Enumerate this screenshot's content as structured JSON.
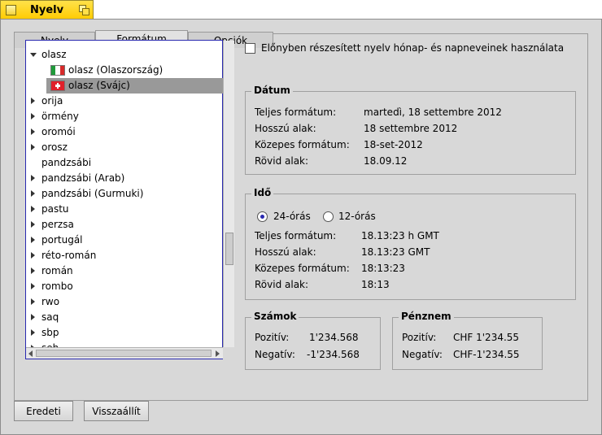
{
  "window": {
    "title": "Nyelv"
  },
  "tabs": [
    {
      "label": "Nyelv",
      "active": false
    },
    {
      "label": "Formátum",
      "active": true
    },
    {
      "label": "Opciók",
      "active": false
    }
  ],
  "list": {
    "items": [
      {
        "label": "olasz",
        "expanded": true,
        "indent": 0
      },
      {
        "label": "olasz (Olaszország)",
        "flag": "it",
        "indent": 1
      },
      {
        "label": "olasz (Svájc)",
        "flag": "ch",
        "indent": 1,
        "selected": true
      },
      {
        "label": "orija",
        "expandable": true,
        "indent": 0
      },
      {
        "label": "örmény",
        "expandable": true,
        "indent": 0
      },
      {
        "label": "oromói",
        "expandable": true,
        "indent": 0
      },
      {
        "label": "orosz",
        "expandable": true,
        "indent": 0
      },
      {
        "label": "pandzsábi",
        "expandable": false,
        "indent": 0
      },
      {
        "label": "pandzsábi (Arab)",
        "expandable": true,
        "indent": 0
      },
      {
        "label": "pandzsábi (Gurmuki)",
        "expandable": true,
        "indent": 0
      },
      {
        "label": "pastu",
        "expandable": true,
        "indent": 0
      },
      {
        "label": "perzsa",
        "expandable": true,
        "indent": 0
      },
      {
        "label": "portugál",
        "expandable": true,
        "indent": 0
      },
      {
        "label": "réto-román",
        "expandable": true,
        "indent": 0
      },
      {
        "label": "román",
        "expandable": true,
        "indent": 0
      },
      {
        "label": "rombo",
        "expandable": true,
        "indent": 0
      },
      {
        "label": "rwo",
        "expandable": true,
        "indent": 0
      },
      {
        "label": "saq",
        "expandable": true,
        "indent": 0
      },
      {
        "label": "sbp",
        "expandable": true,
        "indent": 0
      },
      {
        "label": "seh",
        "expandable": true,
        "indent": 0
      }
    ]
  },
  "preferred_checkbox": {
    "label": "Előnyben részesített nyelv hónap- és napneveinek használata",
    "checked": false
  },
  "date": {
    "title": "Dátum",
    "rows": [
      {
        "label": "Teljes formátum:",
        "value": "martedì, 18 settembre 2012"
      },
      {
        "label": "Hosszú alak:",
        "value": "18 settembre 2012"
      },
      {
        "label": "Közepes formátum:",
        "value": "18-set-2012"
      },
      {
        "label": "Rövid alak:",
        "value": "18.09.12"
      }
    ]
  },
  "time": {
    "title": "Idő",
    "radio_24": "24-órás",
    "radio_12": "12-órás",
    "selected": "24",
    "rows": [
      {
        "label": "Teljes formátum:",
        "value": "18.13:23 h GMT"
      },
      {
        "label": "Hosszú alak:",
        "value": "18.13:23 GMT"
      },
      {
        "label": "Közepes formátum:",
        "value": "18:13:23"
      },
      {
        "label": "Rövid alak:",
        "value": "18:13"
      }
    ]
  },
  "numbers": {
    "title": "Számok",
    "positive_label": "Pozitív:",
    "positive_value": "1'234.568",
    "negative_label": "Negatív:",
    "negative_value": "-1'234.568"
  },
  "currency": {
    "title": "Pénznem",
    "positive_label": "Pozitív:",
    "positive_value": "CHF 1'234.55",
    "negative_label": "Negatív:",
    "negative_value": "CHF-1'234.55"
  },
  "buttons": {
    "defaults": "Eredeti",
    "revert": "Visszaállít"
  },
  "colors": {
    "title_tab": "#ffcb00",
    "window_bg": "#d8d8d8",
    "selection": "#999999",
    "focus": "#2a2ab0"
  },
  "icons": {
    "close": "close-box-icon",
    "zoom": "zoom-box-icon",
    "expand": "triangle-right-icon",
    "collapse": "triangle-down-icon"
  }
}
